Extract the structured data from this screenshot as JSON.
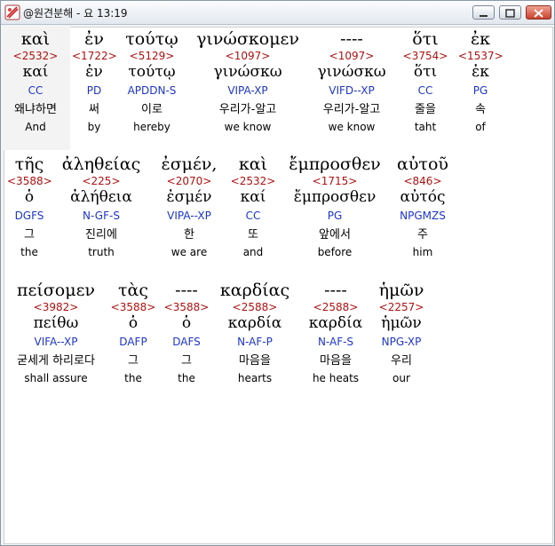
{
  "window": {
    "title": "@원견분해 - 요 13:19"
  },
  "lines": [
    [
      {
        "greek": "καὶ",
        "num": "<2532>",
        "lemma": "καί",
        "parse": "CC",
        "korean": "왜냐하면",
        "english": "And"
      },
      {
        "greek": "ἐν",
        "num": "<1722>",
        "lemma": "ἐν",
        "parse": "PD",
        "korean": "써",
        "english": "by"
      },
      {
        "greek": "τούτῳ",
        "num": "<5129>",
        "lemma": "τούτῳ",
        "parse": "APDDN-S",
        "korean": "이로",
        "english": "hereby"
      },
      {
        "greek": "γινώσκομεν",
        "num": "<1097>",
        "lemma": "γινώσκω",
        "parse": "VIPA-XP",
        "korean": "우리가-알고",
        "english": "we know"
      },
      {
        "greek": "----",
        "num": "<1097>",
        "lemma": "γινώσκω",
        "parse": "VIFD--XP",
        "korean": "우리가-알고",
        "english": "we know"
      },
      {
        "greek": "ὅτι",
        "num": "<3754>",
        "lemma": "ὅτι",
        "parse": "CC",
        "korean": "줄을",
        "english": "taht"
      },
      {
        "greek": "ἐκ",
        "num": "<1537>",
        "lemma": "ἐκ",
        "parse": "PG",
        "korean": "속",
        "english": "of"
      }
    ],
    [
      {
        "greek": "τῆς",
        "num": "<3588>",
        "lemma": "ὁ",
        "parse": "DGFS",
        "korean": "그",
        "english": "the"
      },
      {
        "greek": "ἀληθείας",
        "num": "<225>",
        "lemma": "ἀλήθεια",
        "parse": "N-GF-S",
        "korean": "진리에",
        "english": "truth"
      },
      {
        "greek": "ἐσμέν,",
        "num": "<2070>",
        "lemma": "ἐσμέν",
        "parse": "VIPA--XP",
        "korean": "한",
        "english": "we are"
      },
      {
        "greek": "καὶ",
        "num": "<2532>",
        "lemma": "καί",
        "parse": "CC",
        "korean": "또",
        "english": "and"
      },
      {
        "greek": "ἔμπροσθεν",
        "num": "<1715>",
        "lemma": "ἔμπροσθεν",
        "parse": "PG",
        "korean": "앞에서",
        "english": "before"
      },
      {
        "greek": "αὐτοῦ",
        "num": "<846>",
        "lemma": "αὐτός",
        "parse": "NPGMZS",
        "korean": "주",
        "english": "him"
      }
    ],
    [
      {
        "greek": "πείσομεν",
        "num": "<3982>",
        "lemma": "πείθω",
        "parse": "VIFA--XP",
        "korean": "굳세게 하리로다",
        "english": "shall assure"
      },
      {
        "greek": "τὰς",
        "num": "<3588>",
        "lemma": "ὁ",
        "parse": "DAFP",
        "korean": "그",
        "english": "the"
      },
      {
        "greek": "----",
        "num": "<3588>",
        "lemma": "ὁ",
        "parse": "DAFS",
        "korean": "그",
        "english": "the"
      },
      {
        "greek": "καρδίας",
        "num": "<2588>",
        "lemma": "καρδία",
        "parse": "N-AF-P",
        "korean": "마음을",
        "english": "hearts"
      },
      {
        "greek": "----",
        "num": "<2588>",
        "lemma": "καρδία",
        "parse": "N-AF-S",
        "korean": "마음을",
        "english": "he heats"
      },
      {
        "greek": "ἡμῶν",
        "num": "<2257>",
        "lemma": "ἡμῶν",
        "parse": "NPG-XP",
        "korean": "우리",
        "english": "our"
      }
    ]
  ]
}
